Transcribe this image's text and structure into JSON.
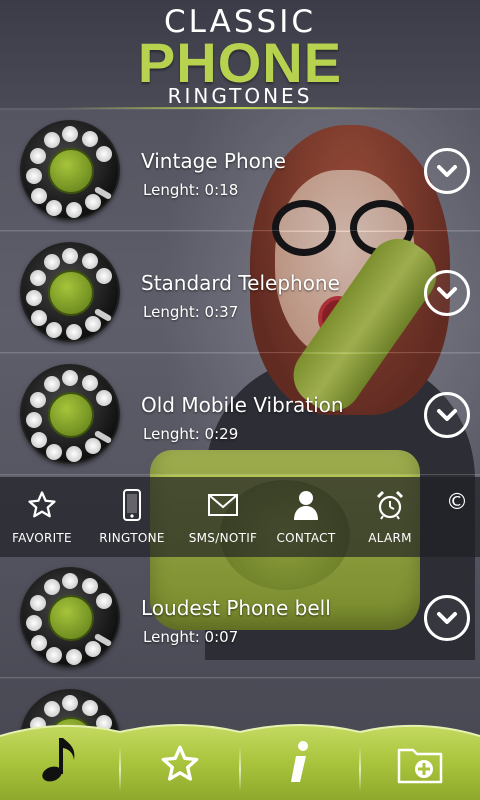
{
  "app": {
    "title_top": "CLASSIC",
    "title_main": "PHONE",
    "title_bottom": "RINGTONES"
  },
  "ringtones": [
    {
      "title": "Vintage Phone",
      "length": "Lenght: 0:18"
    },
    {
      "title": "Standard Telephone",
      "length": "Lenght: 0:37"
    },
    {
      "title": "Old Mobile Vibration",
      "length": "Lenght: 0:29"
    },
    {
      "title": "Loudest Phone bell",
      "length": "Lenght: 0:07"
    },
    {
      "title": "",
      "length": ""
    }
  ],
  "actions": [
    {
      "label": "FAVORITE",
      "icon": "star-outline-icon"
    },
    {
      "label": "RINGTONE",
      "icon": "smartphone-icon"
    },
    {
      "label": "SMS/NOTIF",
      "icon": "envelope-icon"
    },
    {
      "label": "CONTACT",
      "icon": "person-icon"
    },
    {
      "label": "ALARM",
      "icon": "alarm-clock-icon"
    }
  ],
  "copyright_symbol": "©",
  "bottom_nav": [
    {
      "icon": "music-note-icon"
    },
    {
      "icon": "star-icon"
    },
    {
      "icon": "info-icon"
    },
    {
      "icon": "add-folder-icon"
    }
  ],
  "colors": {
    "accent_green": "#b7d24f",
    "nav_green": "#a9c43c",
    "bar_dark": "#2a2a33"
  }
}
